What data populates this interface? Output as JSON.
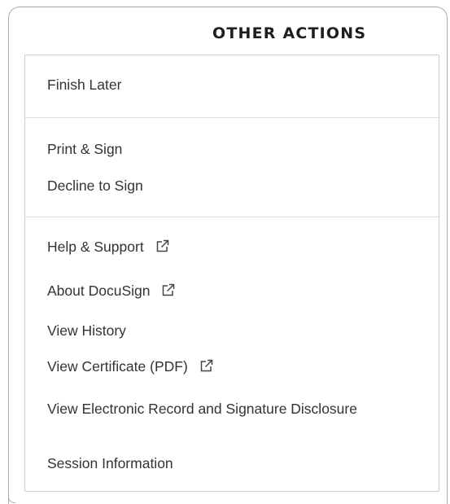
{
  "panel": {
    "title": "OTHER ACTIONS"
  },
  "groups": [
    {
      "items": [
        {
          "label": "Finish Later",
          "external": false
        }
      ]
    },
    {
      "items": [
        {
          "label": "Print & Sign",
          "external": false
        },
        {
          "label": "Decline to Sign",
          "external": false
        }
      ]
    },
    {
      "items": [
        {
          "label": "Help & Support",
          "external": true,
          "icon": "external-link-icon"
        },
        {
          "label": "About DocuSign",
          "external": true,
          "icon": "external-link-icon"
        },
        {
          "label": "View History",
          "external": false
        },
        {
          "label": "View Certificate (PDF)",
          "external": true,
          "icon": "external-link-icon"
        },
        {
          "label": "View Electronic Record and Signature Disclosure",
          "external": false
        },
        {
          "label": "Session Information",
          "external": false
        }
      ]
    }
  ],
  "colors": {
    "text": "#333333",
    "title": "#1e1e1e",
    "border": "#cccccc",
    "divider": "#dddddd"
  }
}
